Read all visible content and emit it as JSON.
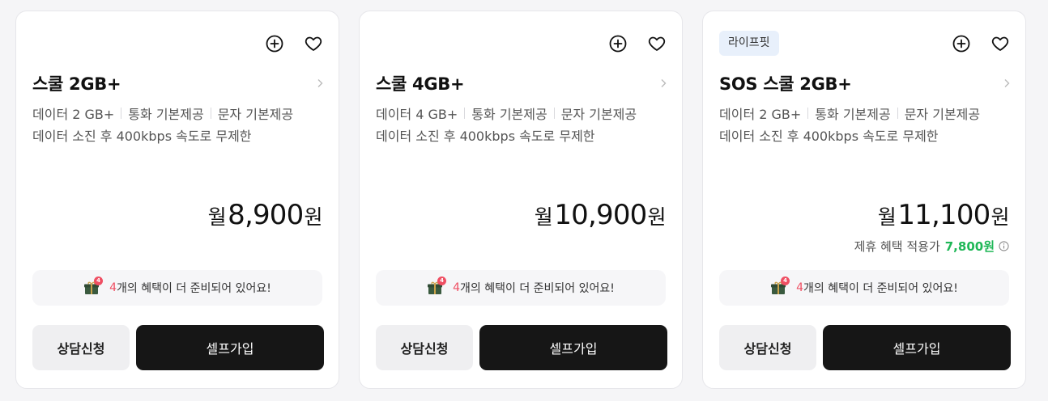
{
  "cards": [
    {
      "name": "스쿨 2GB+",
      "specs": [
        "데이터 2 GB+",
        "통화 기본제공",
        "문자 기본제공"
      ],
      "spec_note": "데이터 소진 후 400kbps 속도로 무제한",
      "price_prefix": "월",
      "price_value": "8,900",
      "price_suffix": "원",
      "benefit_count": "4",
      "benefit_text": "개의 혜택이 더 준비되어 있어요!",
      "gift_badge": "4",
      "consult_label": "상담신청",
      "join_label": "셀프가입"
    },
    {
      "name": "스쿨 4GB+",
      "specs": [
        "데이터 4 GB+",
        "통화 기본제공",
        "문자 기본제공"
      ],
      "spec_note": "데이터 소진 후 400kbps 속도로 무제한",
      "price_prefix": "월",
      "price_value": "10,900",
      "price_suffix": "원",
      "benefit_count": "4",
      "benefit_text": "개의 혜택이 더 준비되어 있어요!",
      "gift_badge": "4",
      "consult_label": "상담신청",
      "join_label": "셀프가입"
    },
    {
      "badge": "라이프핏",
      "name": "SOS 스쿨 2GB+",
      "specs": [
        "데이터 2 GB+",
        "통화 기본제공",
        "문자 기본제공"
      ],
      "spec_note": "데이터 소진 후 400kbps 속도로 무제한",
      "price_prefix": "월",
      "price_value": "11,100",
      "price_suffix": "원",
      "discount_label": "제휴 혜택 적용가",
      "discount_price": "7,800원",
      "benefit_count": "4",
      "benefit_text": "개의 혜택이 더 준비되어 있어요!",
      "gift_badge": "4",
      "consult_label": "상담신청",
      "join_label": "셀프가입"
    }
  ],
  "icons": {
    "add": "plus-circle-icon",
    "heart": "heart-icon",
    "chevron": "chevron-right-icon",
    "gift": "gift-icon",
    "info": "info-icon"
  },
  "colors": {
    "accent_red": "#ef4f63",
    "discount_green": "#1fb757",
    "join_button": "#161616",
    "badge_bg": "#e8f0fb"
  }
}
